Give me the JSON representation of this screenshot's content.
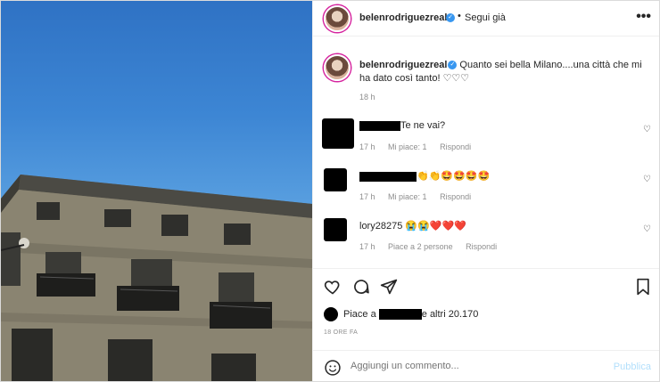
{
  "post": {
    "username": "belenrodriguezreal",
    "verified_mark": "✓",
    "dot": "•",
    "follow_status": "Segui già",
    "more_icon": "•••"
  },
  "caption": {
    "username": "belenrodriguezreal",
    "text": "Quanto sei bella Milano....una città che mi ha dato così tanto! ♡♡♡",
    "time": "18 h"
  },
  "comments": [
    {
      "user": "",
      "text": "Te ne vai?",
      "time": "17 h",
      "likes": "Mi piace: 1",
      "reply": "Rispondi",
      "user_hidden": true
    },
    {
      "user": "",
      "text": "👏👏🤩🤩🤩🤩",
      "time": "17 h",
      "likes": "Mi piace: 1",
      "reply": "Rispondi",
      "user_hidden": true
    },
    {
      "user": "lory28275",
      "text": "😭😭❤️❤️❤️",
      "time": "17 h",
      "likes": "Piace a 2 persone",
      "reply": "Rispondi",
      "user_hidden": false
    }
  ],
  "likes": {
    "prefix": "Piace a",
    "suffix": "e altri 20.170"
  },
  "post_time": "18 ORE FA",
  "add_comment": {
    "placeholder": "Aggiungi un commento...",
    "publish_label": "Pubblica"
  },
  "colors": {
    "sky": "#3d86d4",
    "link_disabled": "#b2dffc",
    "verified": "#3897f0",
    "muted": "#8e8e8e"
  },
  "icons": [
    "verified-badge-icon",
    "more-options-icon",
    "heart-icon",
    "comment-icon",
    "share-icon",
    "bookmark-icon",
    "emoji-icon"
  ]
}
